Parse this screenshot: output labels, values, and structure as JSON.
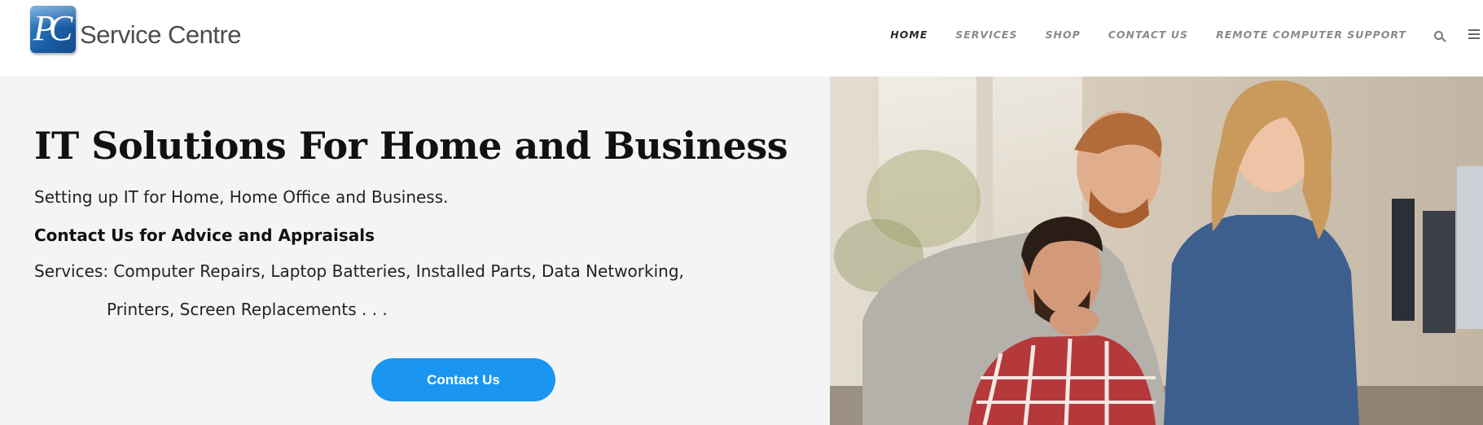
{
  "header": {
    "logo": {
      "mark": "PC",
      "text": "Service Centre"
    },
    "nav": [
      {
        "label": "HOME",
        "active": true
      },
      {
        "label": "SERVICES",
        "active": false
      },
      {
        "label": "SHOP",
        "active": false
      },
      {
        "label": "CONTACT US",
        "active": false
      },
      {
        "label": "REMOTE COMPUTER SUPPORT",
        "active": false
      }
    ],
    "icons": [
      "search-icon",
      "menu-icon"
    ]
  },
  "hero": {
    "title": "IT Solutions For Home and Business",
    "subtitle": "Setting up IT for Home, Home Office and Business.",
    "emphasis": "Contact Us for Advice and Appraisals",
    "services_line1": "Services: Computer Repairs, Laptop Batteries, Installed Parts, Data Networking,",
    "services_line2": "Printers, Screen Replacements . . .",
    "cta_label": "Contact Us",
    "image": "three people looking at a computer screen in an office"
  },
  "colors": {
    "cta": "#1a96f0",
    "nav_active": "#2b2b2b",
    "nav_inactive": "#8a8a8a",
    "hero_bg": "#f4f4f4",
    "logo_blue": "#1b5fa8"
  }
}
